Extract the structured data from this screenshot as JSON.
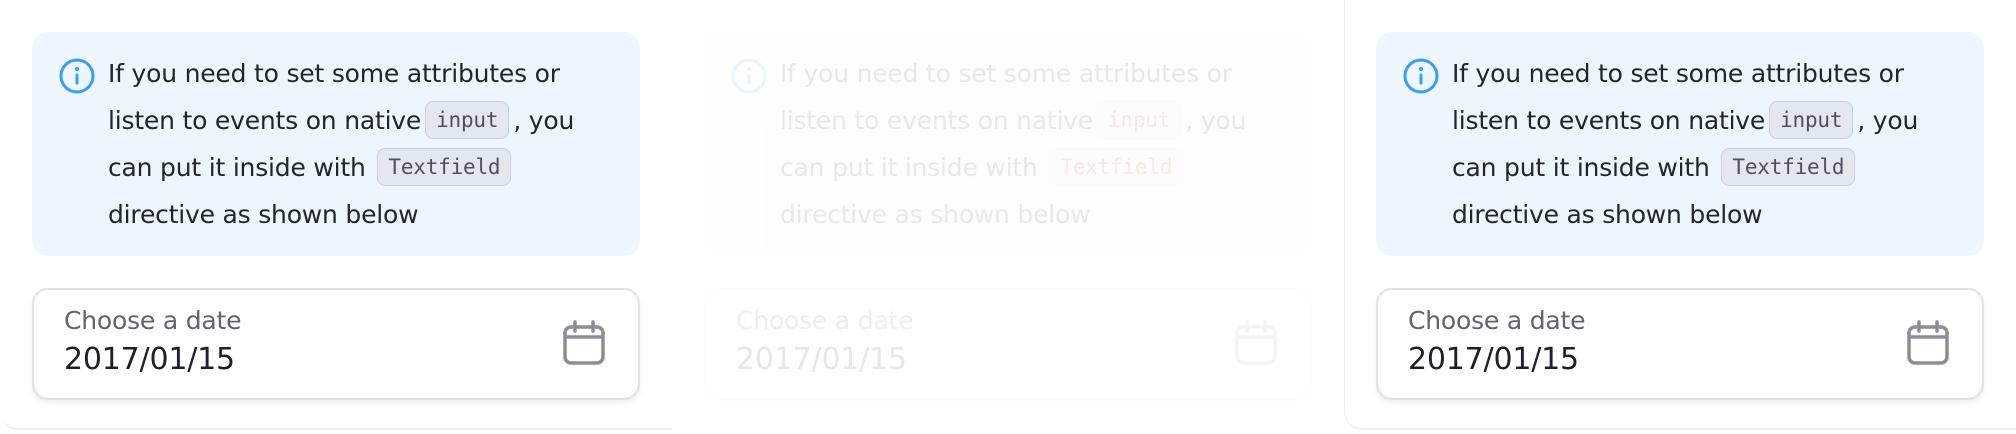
{
  "panels": [
    {
      "variant": "normal",
      "alert": {
        "icon": "info-icon",
        "text_1": "If you need to set some attributes or listen to events on native",
        "code_1": "input",
        "text_2": ", you can put it inside with",
        "code_2": "Textfield",
        "text_3": "directive as shown below"
      },
      "field": {
        "label": "Choose a date",
        "value": "2017/01/15",
        "icon": "calendar-icon"
      }
    },
    {
      "variant": "faded",
      "alert": {
        "icon": "info-icon",
        "text_1": "If you need to set some attributes or listen to events on native",
        "code_1": "input",
        "text_2": ", you can put it inside with",
        "code_2": "Textfield",
        "text_3": "directive as shown below"
      },
      "field": {
        "label": "Choose a date",
        "value": "2017/01/15",
        "icon": "calendar-icon"
      }
    },
    {
      "variant": "normal",
      "alert": {
        "icon": "info-icon",
        "text_1": "If you need to set some attributes or listen to events on native",
        "code_1": "input",
        "text_2": ", you can put it inside with",
        "code_2": "Textfield",
        "text_3": "directive as shown below"
      },
      "field": {
        "label": "Choose a date",
        "value": "2017/01/15",
        "icon": "calendar-icon"
      }
    }
  ],
  "colors": {
    "alert_bg": "#edf5fd",
    "info_icon": "#3d9df5",
    "code_bg": "#e4e8ee",
    "calendar_icon": "#8a8e99",
    "text": "#22252c"
  }
}
